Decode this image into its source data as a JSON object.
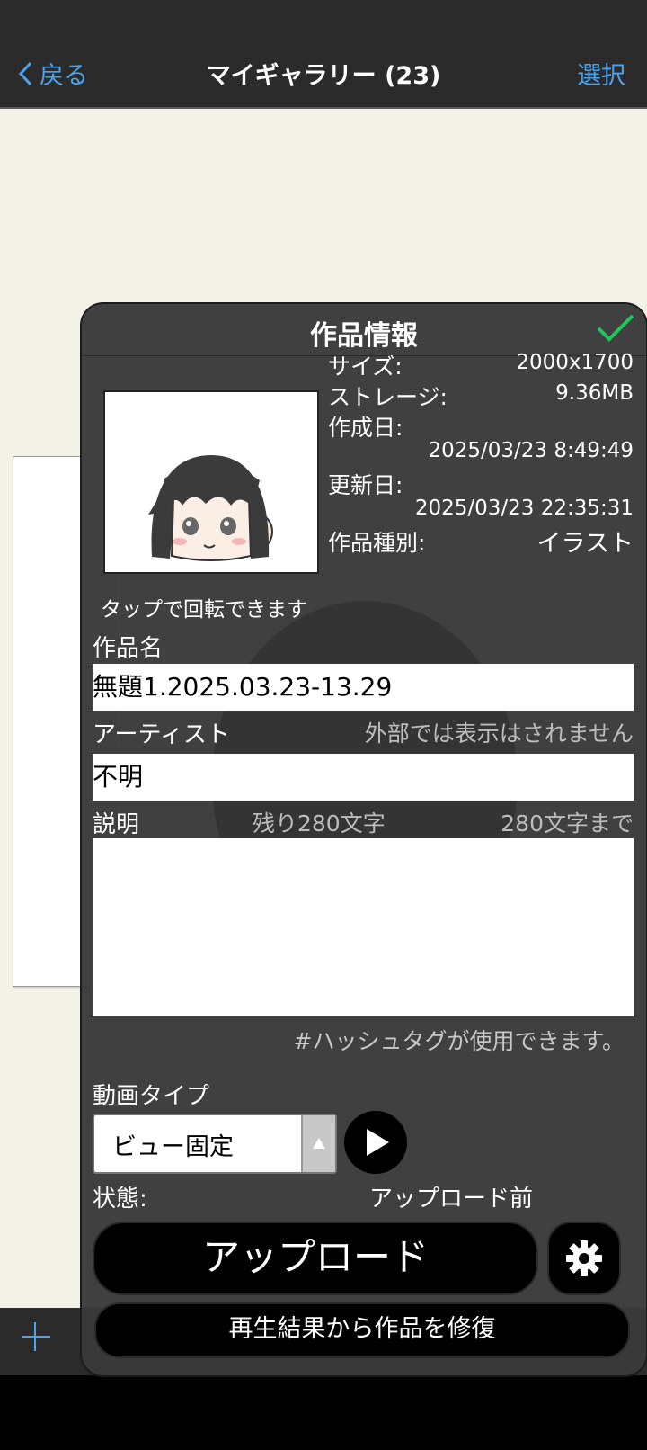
{
  "nav": {
    "back_label": "戻る",
    "title": "マイギャラリー (23)",
    "select_label": "選択"
  },
  "panel": {
    "title": "作品情報",
    "rotate_hint": "タップで回転できます",
    "info": {
      "size_label": "サイズ:",
      "size_value": "2000x1700",
      "storage_label": "ストレージ:",
      "storage_value": "9.36MB",
      "created_label": "作成日:",
      "created_value": "2025/03/23 8:49:49",
      "updated_label": "更新日:",
      "updated_value": "2025/03/23 22:35:31",
      "kind_label": "作品種別:",
      "kind_value": "イラスト"
    },
    "title_field": {
      "label": "作品名",
      "value": "無題1.2025.03.23-13.29"
    },
    "artist_field": {
      "label": "アーティスト",
      "hint": "外部では表示はされません",
      "value": "不明"
    },
    "description_field": {
      "label": "説明",
      "remaining": "残り280文字",
      "limit": "280文字まで",
      "value": ""
    },
    "hashtag_hint": "#ハッシュタグが使用できます。",
    "video_type": {
      "label": "動画タイプ",
      "selected": "ビュー固定"
    },
    "status": {
      "label": "状態:",
      "value": "アップロード前"
    },
    "upload_label": "アップロード",
    "restore_label": "再生結果から作品を修復"
  },
  "icons": {
    "back": "chevron-left-icon",
    "done": "checkmark-icon",
    "play": "play-icon",
    "settings": "gear-icon",
    "add": "plus-icon"
  },
  "colors": {
    "accent": "#4aa3ef",
    "check": "#22c55e",
    "panel_bg": "#3a3a3a",
    "gallery_bg": "#f2f1e6"
  }
}
